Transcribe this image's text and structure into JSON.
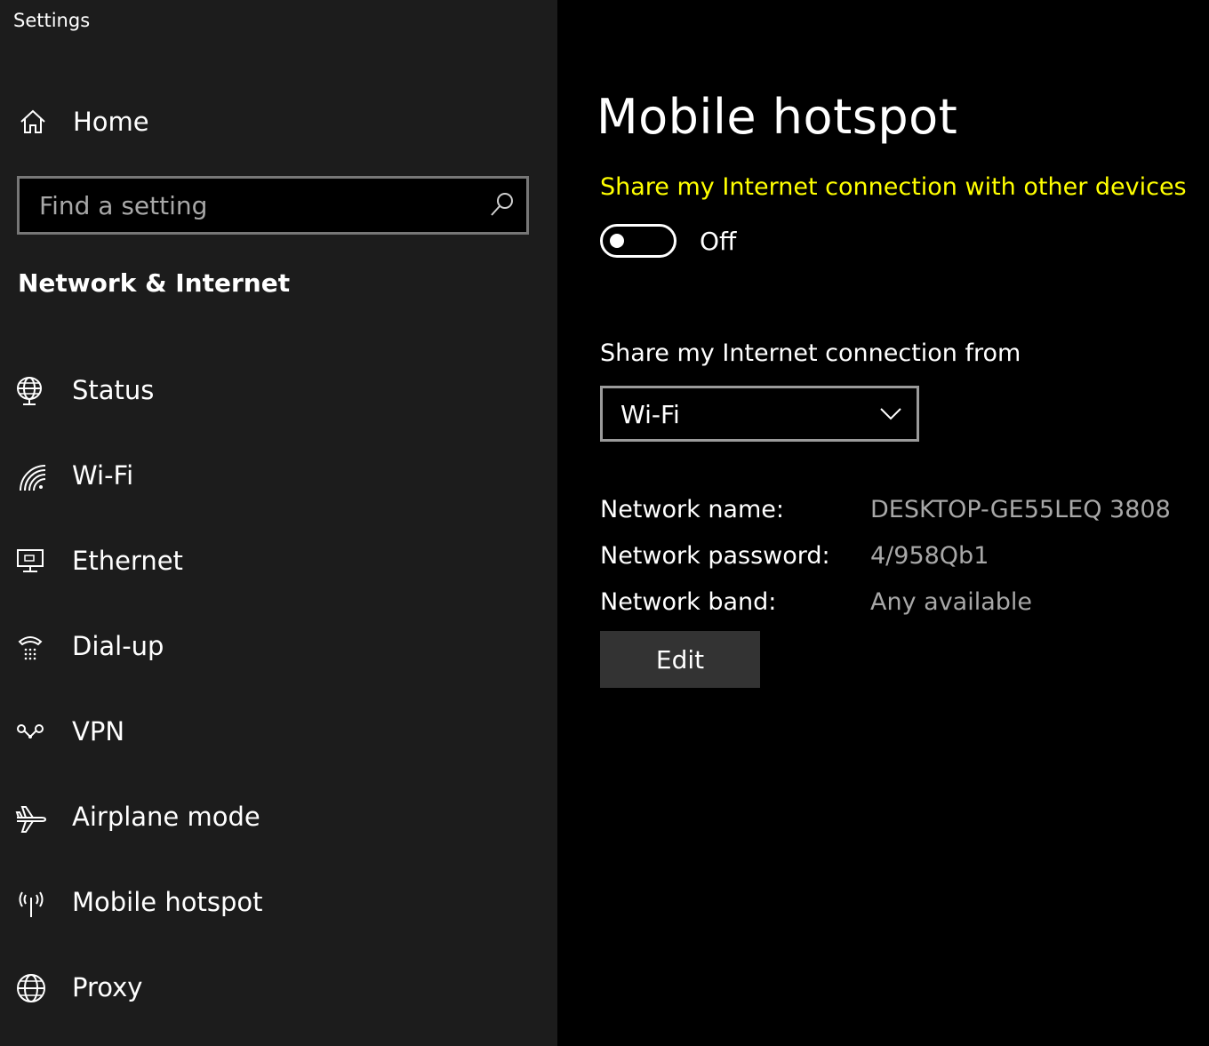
{
  "window": {
    "title": "Settings"
  },
  "sidebar": {
    "home_label": "Home",
    "search": {
      "placeholder": "Find a setting",
      "value": ""
    },
    "section_title": "Network & Internet",
    "items": [
      {
        "label": "Status",
        "icon": "globe-monitor-icon"
      },
      {
        "label": "Wi-Fi",
        "icon": "wifi-icon"
      },
      {
        "label": "Ethernet",
        "icon": "ethernet-icon"
      },
      {
        "label": "Dial-up",
        "icon": "dial-up-icon"
      },
      {
        "label": "VPN",
        "icon": "vpn-icon"
      },
      {
        "label": "Airplane mode",
        "icon": "airplane-icon"
      },
      {
        "label": "Mobile hotspot",
        "icon": "hotspot-icon"
      },
      {
        "label": "Proxy",
        "icon": "globe-icon"
      }
    ]
  },
  "main": {
    "title": "Mobile hotspot",
    "share_header": "Share my Internet connection with other devices",
    "toggle": {
      "state_label": "Off",
      "on": false
    },
    "share_from": {
      "label": "Share my Internet connection from",
      "selected": "Wi-Fi"
    },
    "details": [
      {
        "key": "Network name:",
        "value": "DESKTOP-GE55LEQ 3808"
      },
      {
        "key": "Network password:",
        "value": "4/958Qb1"
      },
      {
        "key": "Network band:",
        "value": "Any available"
      }
    ],
    "edit_label": "Edit"
  },
  "colors": {
    "sidebar_bg": "#1c1c1c",
    "main_bg": "#000000",
    "accent_header": "#ffff00",
    "secondary_text": "#a8a8a8",
    "button_bg": "#333333"
  }
}
